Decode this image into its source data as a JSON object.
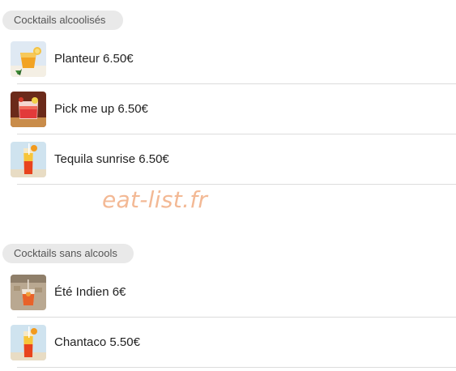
{
  "sections": [
    {
      "title": "Cocktails alcoolisés",
      "items": [
        {
          "label": "Planteur 6.50€",
          "icon": "planteur-cocktail-icon"
        },
        {
          "label": "Pick me up 6.50€",
          "icon": "pick-me-up-cocktail-icon"
        },
        {
          "label": "Tequila sunrise 6.50€",
          "icon": "tequila-sunrise-cocktail-icon"
        }
      ]
    },
    {
      "title": "Cocktails sans alcools",
      "items": [
        {
          "label": "Été Indien 6€",
          "icon": "ete-indien-cocktail-icon"
        },
        {
          "label": "Chantaco 5.50€",
          "icon": "chantaco-cocktail-icon"
        }
      ]
    }
  ],
  "watermark": "eat-list.fr",
  "colors": {
    "pill_background": "#e9e9e9",
    "watermark": "#f3b995",
    "divider": "#dcdcdc"
  }
}
